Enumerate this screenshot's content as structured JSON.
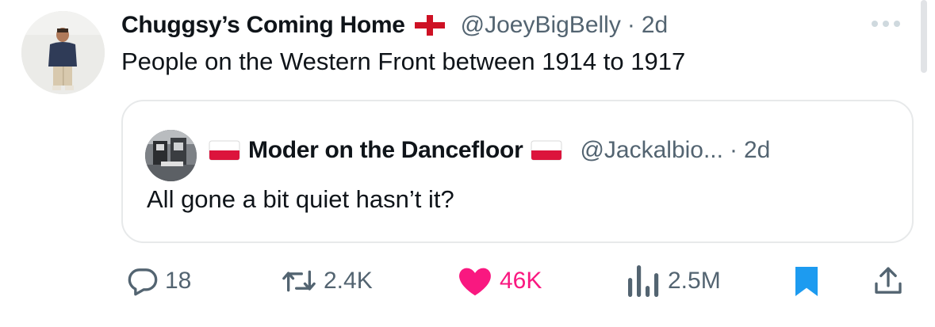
{
  "tweet": {
    "display_name": "Chuggsy’s Coming Home",
    "name_emoji": "england-flag",
    "handle": "@JoeyBigBelly",
    "separator": "·",
    "time": "2d",
    "text": "People on the Western Front between 1914 to 1917"
  },
  "quote": {
    "display_name": "Moder on the Dancefloor",
    "name_emoji": "poland-flag",
    "handle": "@Jackalbio...",
    "separator": "·",
    "time": "2d",
    "text": "All gone a bit quiet hasn’t it?"
  },
  "actions": {
    "replies": "18",
    "reposts": "2.4K",
    "likes": "46K",
    "views": "2.5M"
  },
  "colors": {
    "text": "#0f1419",
    "secondary": "#536471",
    "like": "#f91880",
    "bookmark": "#1d9bf0",
    "border": "#e7e9ea"
  },
  "icons": [
    "reply-icon",
    "repost-icon",
    "heart-icon",
    "views-icon",
    "bookmark-icon",
    "share-icon",
    "more-icon"
  ]
}
